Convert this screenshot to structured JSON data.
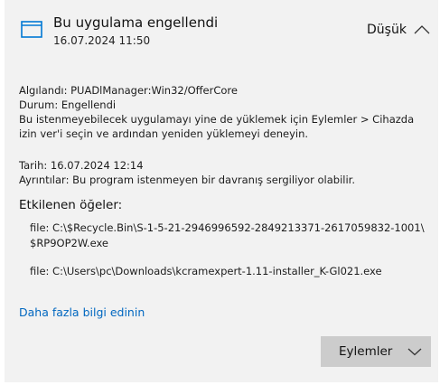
{
  "notification": {
    "title": "Bu uygulama engellendi",
    "timestamp": "16.07.2024 11:50",
    "severity": "Düşük",
    "icons": {
      "app": "app-window-icon",
      "collapse": "chevron-up-icon",
      "actions": "chevron-down-icon"
    }
  },
  "details": {
    "detected": "Algılandı: PUADlManager:Win32/OfferCore",
    "status": "Durum:  Engellendi",
    "instruction": "Bu istenmeyebilecek uygulamayı yine de yüklemek için Eylemler > Cihazda izin ver'i seçin ve ardından yeniden yüklemeyi deneyin.",
    "date": "Tarih: 16.07.2024 12:14",
    "description": "Ayrıntılar: Bu program istenmeyen bir davranış sergiliyor olabilir."
  },
  "affected": {
    "heading": "Etkilenen öğeler:",
    "items": [
      "file: C:\\$Recycle.Bin\\S-1-5-21-2946996592-2849213371-2617059832-1001\\ $RP9OP2W.exe",
      "file: C:\\Users\\pc\\Downloads\\kcramexpert-1.11-installer_K-Gl021.exe"
    ]
  },
  "links": {
    "learn_more": "Daha fazla bilgi edinin"
  },
  "actions": {
    "label": "Eylemler"
  },
  "colors": {
    "card_background": "#f2f2f2",
    "link": "#0067c0",
    "button": "#cccccc",
    "icon_accent": "#0078d4"
  }
}
